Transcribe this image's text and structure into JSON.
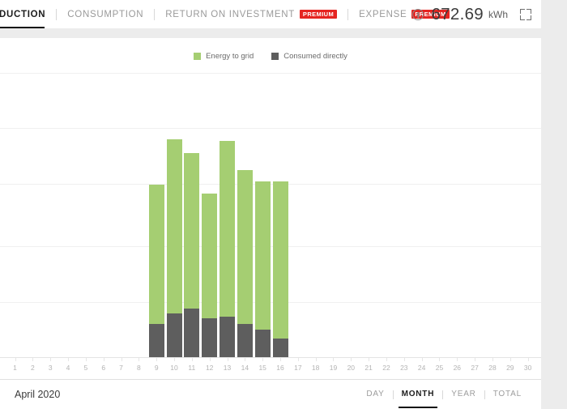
{
  "header": {
    "tabs": [
      {
        "label": "DUCTION",
        "full": "PRODUCTION",
        "active": true,
        "premium": false
      },
      {
        "label": "CONSUMPTION",
        "full": "CONSUMPTION",
        "active": false,
        "premium": false
      },
      {
        "label": "RETURN ON INVESTMENT",
        "full": "RETURN ON INVESTMENT",
        "active": false,
        "premium": true
      },
      {
        "label": "EXPENSE",
        "full": "EXPENSE",
        "active": false,
        "premium": true
      }
    ],
    "premium_badge": "PREMIUM",
    "info_icon": "info-circle-icon",
    "total_value": "672.69",
    "total_unit": "kWh",
    "expand_icon": "fullscreen-icon"
  },
  "footer": {
    "period_label": "April 2020",
    "ranges": [
      {
        "label": "DAY",
        "active": false
      },
      {
        "label": "MONTH",
        "active": true
      },
      {
        "label": "YEAR",
        "active": false
      },
      {
        "label": "TOTAL",
        "active": false
      }
    ]
  },
  "colors": {
    "energy_to_grid": "#a5ce72",
    "consumed_directly": "#5e5e5e",
    "premium_badge": "#e52421",
    "accent_underline": "#111111",
    "page_background": "#ececec",
    "gridline": "#f0f0f0"
  },
  "chart_data": {
    "type": "bar",
    "title": "",
    "subtitle": "",
    "xlabel": "",
    "ylabel": "",
    "stacked": true,
    "grid": true,
    "legend_position": "top-center",
    "axis_ranges": {
      "x": [
        1,
        30
      ],
      "y": [
        0,
        41
      ]
    },
    "gridline_values": [
      41,
      33,
      25,
      16,
      8,
      0
    ],
    "categories": [
      1,
      2,
      3,
      4,
      5,
      6,
      7,
      8,
      9,
      10,
      11,
      12,
      13,
      14,
      15,
      16,
      17,
      18,
      19,
      20,
      21,
      22,
      23,
      24,
      25,
      26,
      27,
      28,
      29,
      30
    ],
    "series": [
      {
        "name": "Consumed directly",
        "color": "#5e5e5e",
        "values": [
          0,
          0,
          0,
          0,
          0,
          0,
          0,
          0,
          4.8,
          6.3,
          7.0,
          5.6,
          5.8,
          4.8,
          4.0,
          2.7,
          0,
          0,
          0,
          0,
          0,
          0,
          0,
          0,
          0,
          0,
          0,
          0,
          0,
          0
        ]
      },
      {
        "name": "Energy to grid",
        "color": "#a5ce72",
        "values": [
          0,
          0,
          0,
          0,
          0,
          0,
          0,
          0,
          20.1,
          25.1,
          22.4,
          18.0,
          25.4,
          22.2,
          21.3,
          22.6,
          0,
          0,
          0,
          0,
          0,
          0,
          0,
          0,
          0,
          0,
          0,
          0,
          0,
          0
        ]
      }
    ],
    "totals": [
      0,
      0,
      0,
      0,
      0,
      0,
      0,
      0,
      24.9,
      31.4,
      29.4,
      23.6,
      31.2,
      27.0,
      25.3,
      25.3,
      0,
      0,
      0,
      0,
      0,
      0,
      0,
      0,
      0,
      0,
      0,
      0,
      0,
      0
    ],
    "total_label": "672.69 kWh"
  }
}
